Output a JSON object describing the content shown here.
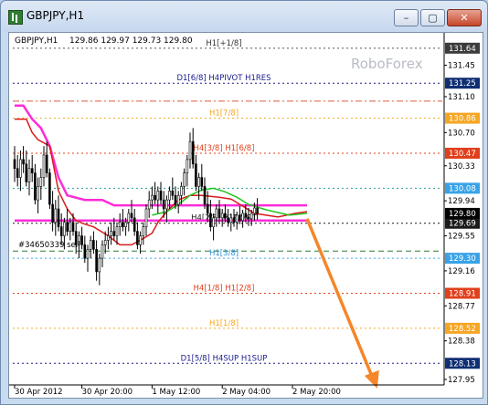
{
  "window": {
    "title": "GBPJPY,H1",
    "controls": {
      "minimize": "–",
      "maximize": "▢",
      "close": "✕"
    }
  },
  "chart": {
    "symbol_label": "GBPJPY,H1",
    "ohlc": "129.86 129.97 129.73 129.80",
    "watermark": "RoboForex",
    "order_label": "#34650339 sell"
  },
  "chart_data": {
    "type": "candlestick",
    "symbol": "GBPJPY",
    "timeframe": "H1",
    "ylim": [
      127.95,
      131.75
    ],
    "price_ticks": [
      {
        "value": 131.45,
        "label": "131.45"
      },
      {
        "value": 131.1,
        "label": "131.10"
      },
      {
        "value": 130.7,
        "label": "130.70"
      },
      {
        "value": 130.33,
        "label": "130.33"
      },
      {
        "value": 129.94,
        "label": "129.94"
      },
      {
        "value": 129.55,
        "label": "129.55"
      },
      {
        "value": 129.16,
        "label": "129.16"
      },
      {
        "value": 128.77,
        "label": "128.77"
      },
      {
        "value": 128.38,
        "label": "128.38"
      },
      {
        "value": 127.95,
        "label": "127.95"
      }
    ],
    "x_ticks": [
      {
        "bar": 0,
        "label": "30 Apr 2012"
      },
      {
        "bar": 23,
        "label": "30 Apr 20:00"
      },
      {
        "bar": 47,
        "label": "1 May 12:00"
      },
      {
        "bar": 71,
        "label": "2 May 04:00"
      },
      {
        "bar": 95,
        "label": "2 May 20:00"
      }
    ],
    "levels": [
      {
        "label": "H1[+1/8]",
        "value": 131.64,
        "color": "#555555",
        "style": "dot",
        "tag_bg": "#3c3c3c",
        "label_color": "#333333"
      },
      {
        "label": "D1[6/8] H4PIVOT H1RES",
        "value": 131.25,
        "color": "#1a1a8c",
        "style": "dot",
        "tag_bg": "#0f2f73",
        "label_color": "#1a1a8c"
      },
      {
        "label": "",
        "value": 131.05,
        "color": "#e05a3a",
        "style": "dashdot",
        "tag_bg": "",
        "label_color": ""
      },
      {
        "label": "H1[7/8]",
        "value": 130.86,
        "color": "#f5a623",
        "style": "dot",
        "tag_bg": "#f5a623",
        "label_color": "#f5a623"
      },
      {
        "label": "H4[3/8] H1[6/8]",
        "value": 130.47,
        "color": "#e0401c",
        "style": "dot",
        "tag_bg": "#e0401c",
        "label_color": "#e0401c"
      },
      {
        "label": "",
        "value": 130.08,
        "color": "#2aa198",
        "style": "dot",
        "tag_bg": "#39a3e6",
        "label_color": ""
      },
      {
        "label": "H4[2/8] H1PIVOT",
        "value": 129.69,
        "color": "#1a1a1a",
        "style": "dot",
        "tag_bg": "#1a1a1a",
        "label_color": "#1a1a1a"
      },
      {
        "label": "",
        "value": 129.38,
        "color": "#2e7d32",
        "style": "dash",
        "tag_bg": "",
        "label_color": ""
      },
      {
        "label": "H1[3/8]",
        "value": 129.3,
        "color": "#39a3e6",
        "style": "dot",
        "tag_bg": "#39a3e6",
        "label_color": "#2b8fd6"
      },
      {
        "label": "H4[1/8] H1[2/8]",
        "value": 128.91,
        "color": "#e0401c",
        "style": "dot",
        "tag_bg": "#e0401c",
        "label_color": "#e0401c"
      },
      {
        "label": "H1[1/8]",
        "value": 128.52,
        "color": "#f5a623",
        "style": "dot",
        "tag_bg": "#f5a623",
        "label_color": "#f5a623"
      },
      {
        "label": "D1[5/8] H4SUP H1SUP",
        "value": 128.13,
        "color": "#1a1a8c",
        "style": "dot",
        "tag_bg": "#0f2f73",
        "label_color": "#1a1a8c"
      }
    ],
    "current_price": {
      "value": 129.8,
      "label": "129.80",
      "tag_bg": "#000000"
    },
    "h4_line": [
      [
        0,
        131.0
      ],
      [
        3,
        131.0
      ],
      [
        6,
        130.85
      ],
      [
        9,
        130.75
      ],
      [
        12,
        130.55
      ],
      [
        15,
        130.2
      ],
      [
        18,
        130.0
      ],
      [
        24,
        129.95
      ],
      [
        30,
        129.95
      ],
      [
        34,
        129.89
      ],
      [
        72,
        129.89
      ],
      [
        100,
        129.89
      ]
    ],
    "bar_line": [
      [
        0,
        129.72
      ],
      [
        100,
        129.72
      ]
    ],
    "red_line": [
      [
        0,
        130.85
      ],
      [
        4,
        130.85
      ],
      [
        6,
        130.7
      ],
      [
        8,
        130.62
      ],
      [
        12,
        130.55
      ],
      [
        15,
        130.05
      ],
      [
        18,
        129.85
      ],
      [
        21,
        129.72
      ],
      [
        24,
        129.68
      ],
      [
        27,
        129.65
      ],
      [
        32,
        129.55
      ],
      [
        36,
        129.45
      ],
      [
        40,
        129.45
      ],
      [
        44,
        129.52
      ],
      [
        47,
        129.58
      ],
      [
        49,
        129.7
      ],
      [
        52,
        129.82
      ],
      [
        56,
        129.95
      ],
      [
        60,
        130.0
      ],
      [
        64,
        130.0
      ],
      [
        70,
        129.98
      ],
      [
        74,
        129.96
      ],
      [
        78,
        129.88
      ],
      [
        82,
        129.8
      ],
      [
        86,
        129.78
      ],
      [
        90,
        129.76
      ],
      [
        96,
        129.8
      ],
      [
        100,
        129.82
      ]
    ],
    "green_line": [
      [
        47,
        129.78
      ],
      [
        52,
        129.82
      ],
      [
        56,
        129.9
      ],
      [
        60,
        130.0
      ],
      [
        64,
        130.06
      ],
      [
        68,
        130.08
      ],
      [
        72,
        130.04
      ],
      [
        76,
        129.98
      ],
      [
        80,
        129.9
      ],
      [
        86,
        129.84
      ],
      [
        94,
        129.78
      ],
      [
        100,
        129.8
      ]
    ],
    "candles": [
      [
        130.4,
        130.55,
        130.15,
        130.3
      ],
      [
        130.3,
        130.45,
        130.1,
        130.2
      ],
      [
        130.2,
        130.5,
        130.05,
        130.4
      ],
      [
        130.4,
        130.55,
        130.25,
        130.35
      ],
      [
        130.35,
        130.5,
        130.1,
        130.15
      ],
      [
        130.15,
        130.4,
        130.0,
        130.3
      ],
      [
        130.3,
        130.45,
        130.15,
        130.25
      ],
      [
        130.25,
        130.35,
        129.9,
        129.95
      ],
      [
        129.95,
        130.2,
        129.8,
        130.1
      ],
      [
        130.1,
        130.3,
        129.95,
        130.2
      ],
      [
        130.2,
        130.55,
        130.1,
        130.45
      ],
      [
        130.45,
        130.6,
        130.2,
        130.25
      ],
      [
        130.25,
        130.3,
        129.85,
        129.9
      ],
      [
        129.9,
        130.05,
        129.6,
        129.7
      ],
      [
        129.7,
        129.95,
        129.55,
        129.85
      ],
      [
        129.85,
        130.0,
        129.6,
        129.65
      ],
      [
        129.65,
        129.8,
        129.45,
        129.55
      ],
      [
        129.55,
        129.75,
        129.4,
        129.7
      ],
      [
        129.7,
        129.85,
        129.55,
        129.6
      ],
      [
        129.6,
        129.75,
        129.5,
        129.7
      ],
      [
        129.7,
        129.8,
        129.55,
        129.6
      ],
      [
        129.6,
        129.7,
        129.35,
        129.45
      ],
      [
        129.45,
        129.6,
        129.3,
        129.55
      ],
      [
        129.55,
        129.65,
        129.4,
        129.45
      ],
      [
        129.45,
        129.55,
        129.25,
        129.3
      ],
      [
        129.3,
        129.45,
        129.15,
        129.4
      ],
      [
        129.4,
        129.55,
        129.3,
        129.5
      ],
      [
        129.5,
        129.6,
        129.35,
        129.4
      ],
      [
        129.4,
        129.5,
        129.05,
        129.15
      ],
      [
        129.15,
        129.35,
        129.0,
        129.3
      ],
      [
        129.3,
        129.5,
        129.2,
        129.45
      ],
      [
        129.45,
        129.6,
        129.35,
        129.5
      ],
      [
        129.5,
        129.65,
        129.4,
        129.55
      ],
      [
        129.55,
        129.7,
        129.45,
        129.6
      ],
      [
        129.6,
        129.75,
        129.5,
        129.55
      ],
      [
        129.55,
        129.7,
        129.45,
        129.65
      ],
      [
        129.65,
        129.8,
        129.55,
        129.7
      ],
      [
        129.7,
        129.85,
        129.6,
        129.65
      ],
      [
        129.65,
        129.75,
        129.55,
        129.7
      ],
      [
        129.7,
        129.85,
        129.6,
        129.8
      ],
      [
        129.8,
        129.95,
        129.7,
        129.75
      ],
      [
        129.75,
        129.85,
        129.55,
        129.6
      ],
      [
        129.6,
        129.7,
        129.4,
        129.45
      ],
      [
        129.45,
        129.6,
        129.35,
        129.55
      ],
      [
        129.55,
        129.7,
        129.45,
        129.65
      ],
      [
        129.65,
        129.9,
        129.55,
        129.85
      ],
      [
        129.85,
        130.05,
        129.75,
        129.95
      ],
      [
        129.95,
        130.1,
        129.85,
        130.0
      ],
      [
        130.0,
        130.15,
        129.9,
        129.95
      ],
      [
        129.95,
        130.1,
        129.8,
        130.05
      ],
      [
        130.05,
        130.15,
        129.9,
        129.95
      ],
      [
        129.95,
        130.05,
        129.75,
        129.85
      ],
      [
        129.85,
        130.0,
        129.7,
        129.95
      ],
      [
        129.95,
        130.1,
        129.85,
        130.05
      ],
      [
        130.05,
        130.2,
        129.95,
        130.0
      ],
      [
        130.0,
        130.1,
        129.85,
        129.9
      ],
      [
        129.9,
        130.05,
        129.8,
        130.0
      ],
      [
        130.0,
        130.15,
        129.9,
        130.1
      ],
      [
        130.1,
        130.3,
        130.0,
        130.25
      ],
      [
        130.25,
        130.45,
        130.1,
        130.4
      ],
      [
        130.4,
        130.7,
        130.3,
        130.6
      ],
      [
        130.6,
        130.75,
        130.3,
        130.35
      ],
      [
        130.35,
        130.45,
        130.05,
        130.1
      ],
      [
        130.1,
        130.25,
        129.95,
        130.2
      ],
      [
        130.2,
        130.35,
        130.05,
        130.1
      ],
      [
        130.1,
        130.2,
        129.85,
        129.9
      ],
      [
        129.9,
        130.05,
        129.7,
        129.8
      ],
      [
        129.8,
        129.95,
        129.6,
        129.65
      ],
      [
        129.65,
        129.8,
        129.5,
        129.75
      ],
      [
        129.75,
        129.9,
        129.65,
        129.85
      ],
      [
        129.85,
        129.95,
        129.7,
        129.75
      ],
      [
        129.75,
        129.85,
        129.65,
        129.8
      ],
      [
        129.8,
        129.9,
        129.7,
        129.75
      ],
      [
        129.75,
        129.85,
        129.65,
        129.7
      ],
      [
        129.7,
        129.8,
        129.6,
        129.75
      ],
      [
        129.75,
        129.85,
        129.65,
        129.7
      ],
      [
        129.7,
        129.82,
        129.62,
        129.78
      ],
      [
        129.78,
        129.88,
        129.68,
        129.72
      ],
      [
        129.72,
        129.84,
        129.64,
        129.8
      ],
      [
        129.8,
        129.9,
        129.7,
        129.76
      ],
      [
        129.76,
        129.86,
        129.66,
        129.74
      ],
      [
        129.74,
        129.84,
        129.66,
        129.8
      ],
      [
        129.8,
        129.92,
        129.72,
        129.86
      ],
      [
        129.86,
        129.97,
        129.73,
        129.8
      ]
    ],
    "forecast_arrow": {
      "from_bar": 100,
      "from_price": 129.74,
      "to_bar": 124,
      "to_price": 127.85,
      "color": "#f5862a"
    }
  }
}
